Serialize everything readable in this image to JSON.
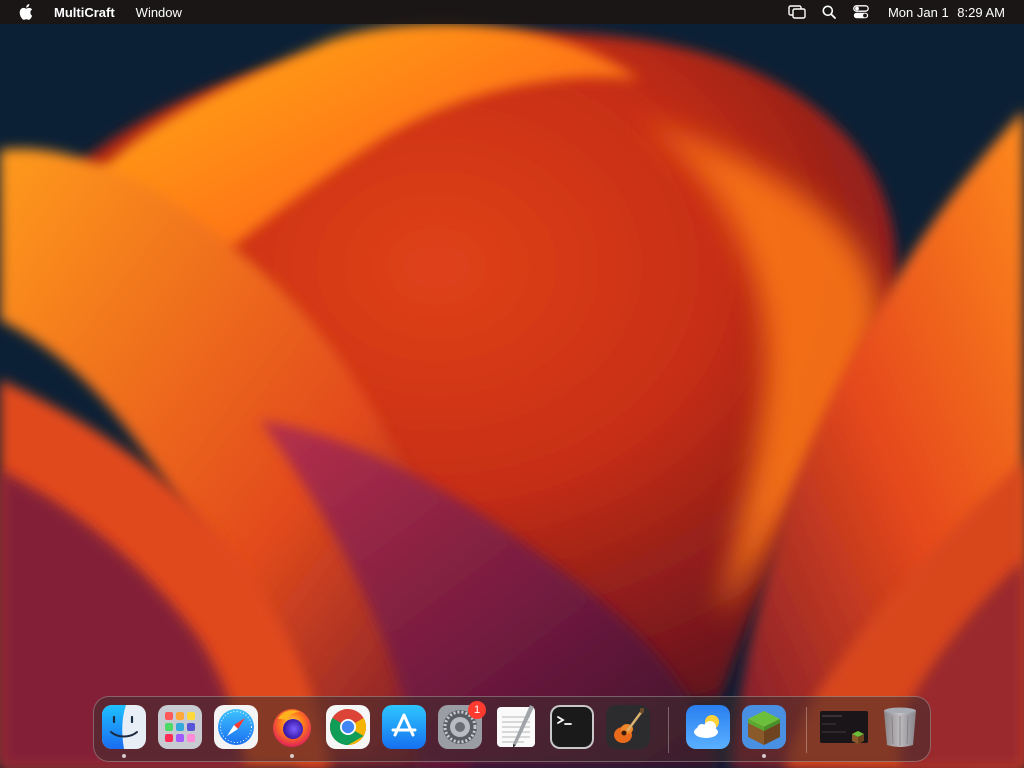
{
  "menubar": {
    "app_name": "MultiCraft",
    "menus": [
      "Window"
    ],
    "clock": {
      "date": "Mon Jan 1",
      "time": "8:29 AM"
    }
  },
  "dock": {
    "apps": [
      {
        "name": "Finder",
        "icon": "finder-icon",
        "running": true
      },
      {
        "name": "Launchpad",
        "icon": "launchpad-icon",
        "running": false
      },
      {
        "name": "Safari",
        "icon": "safari-icon",
        "running": false
      },
      {
        "name": "Firefox",
        "icon": "firefox-icon",
        "running": true
      },
      {
        "name": "Google Chrome",
        "icon": "chrome-icon",
        "running": false
      },
      {
        "name": "App Store",
        "icon": "app-store-icon",
        "running": false
      },
      {
        "name": "System Settings",
        "icon": "settings-gear-icon",
        "running": false,
        "badge": "1"
      },
      {
        "name": "TextEdit",
        "icon": "textedit-icon",
        "running": false
      },
      {
        "name": "Terminal",
        "icon": "terminal-icon",
        "running": false
      },
      {
        "name": "GarageBand",
        "icon": "garageband-guitar-icon",
        "running": false
      }
    ],
    "recent_apps": [
      {
        "name": "Weather",
        "icon": "weather-icon",
        "running": false
      },
      {
        "name": "MultiCraft",
        "icon": "multicraft-grass-block-icon",
        "running": true
      }
    ],
    "extras": [
      {
        "name": "Minimized Window",
        "icon": "minimized-window-thumbnail"
      },
      {
        "name": "Trash",
        "icon": "trash-icon"
      }
    ]
  }
}
